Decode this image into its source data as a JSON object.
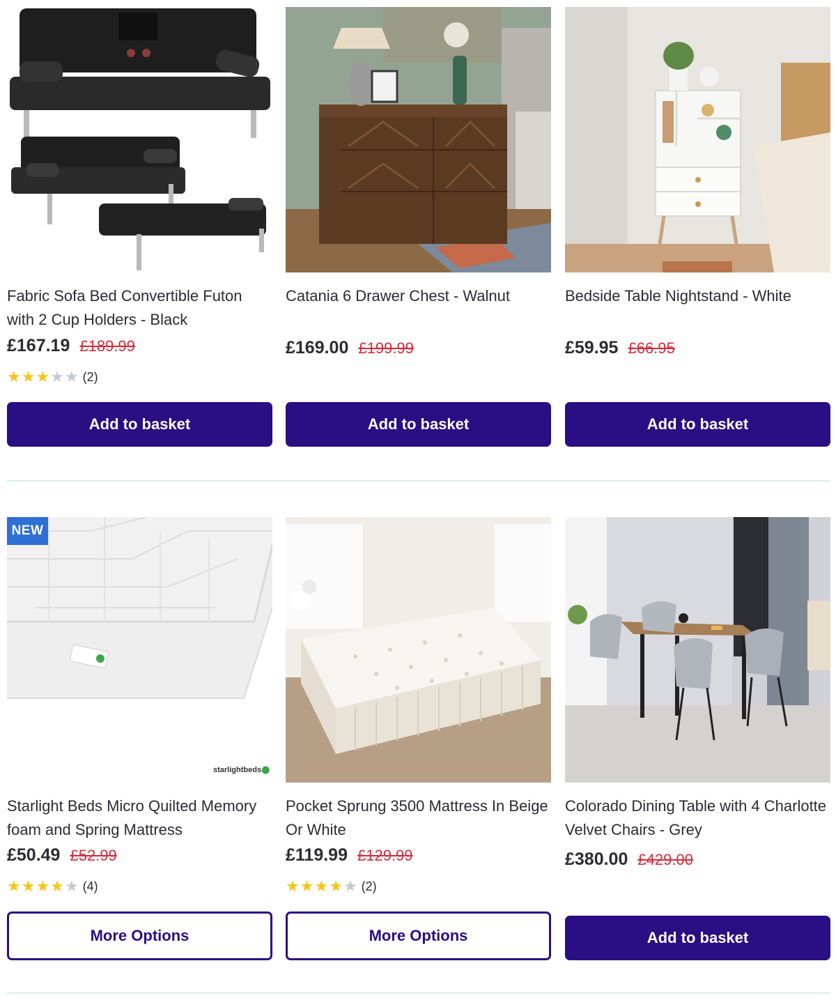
{
  "colors": {
    "accent": "#2a0e83",
    "sale_price": "#d42c3b",
    "star": "#f5c518",
    "badge": "#2f6fd6",
    "divider": "#d7efe9"
  },
  "products": [
    {
      "title": "Fabric Sofa Bed Convertible Futon with 2 Cup Holders - Black",
      "price": "£167.19",
      "was_price": "£189.99",
      "rating": 3,
      "review_count": "(2)",
      "button_label": "Add to basket",
      "image": "black-futon-sofa-bed-image"
    },
    {
      "title": "Catania 6 Drawer Chest - Walnut",
      "price": "£169.00",
      "was_price": "£199.99",
      "button_label": "Add to basket",
      "image": "walnut-chest-of-drawers-image"
    },
    {
      "title": "Bedside Table Nightstand - White",
      "price": "£59.95",
      "was_price": "£66.95",
      "button_label": "Add to basket",
      "image": "white-bedside-table-image"
    },
    {
      "title": "Starlight Beds Micro Quilted Memory foam and Spring Mattress",
      "badge": "NEW",
      "price": "£50.49",
      "was_price": "£52.99",
      "rating": 4,
      "review_count": "(4)",
      "button_label": "More Options",
      "image": "quilted-mattress-image",
      "image_logo_text": "starlightbeds"
    },
    {
      "title": "Pocket Sprung 3500 Mattress In Beige Or White",
      "price": "£119.99",
      "was_price": "£129.99",
      "rating": 4,
      "review_count": "(2)",
      "button_label": "More Options",
      "image": "pocket-sprung-mattress-image"
    },
    {
      "title": "Colorado Dining Table with 4 Charlotte Velvet Chairs - Grey",
      "price": "£380.00",
      "was_price": "£429.00",
      "button_label": "Add to basket",
      "image": "dining-set-image"
    }
  ]
}
